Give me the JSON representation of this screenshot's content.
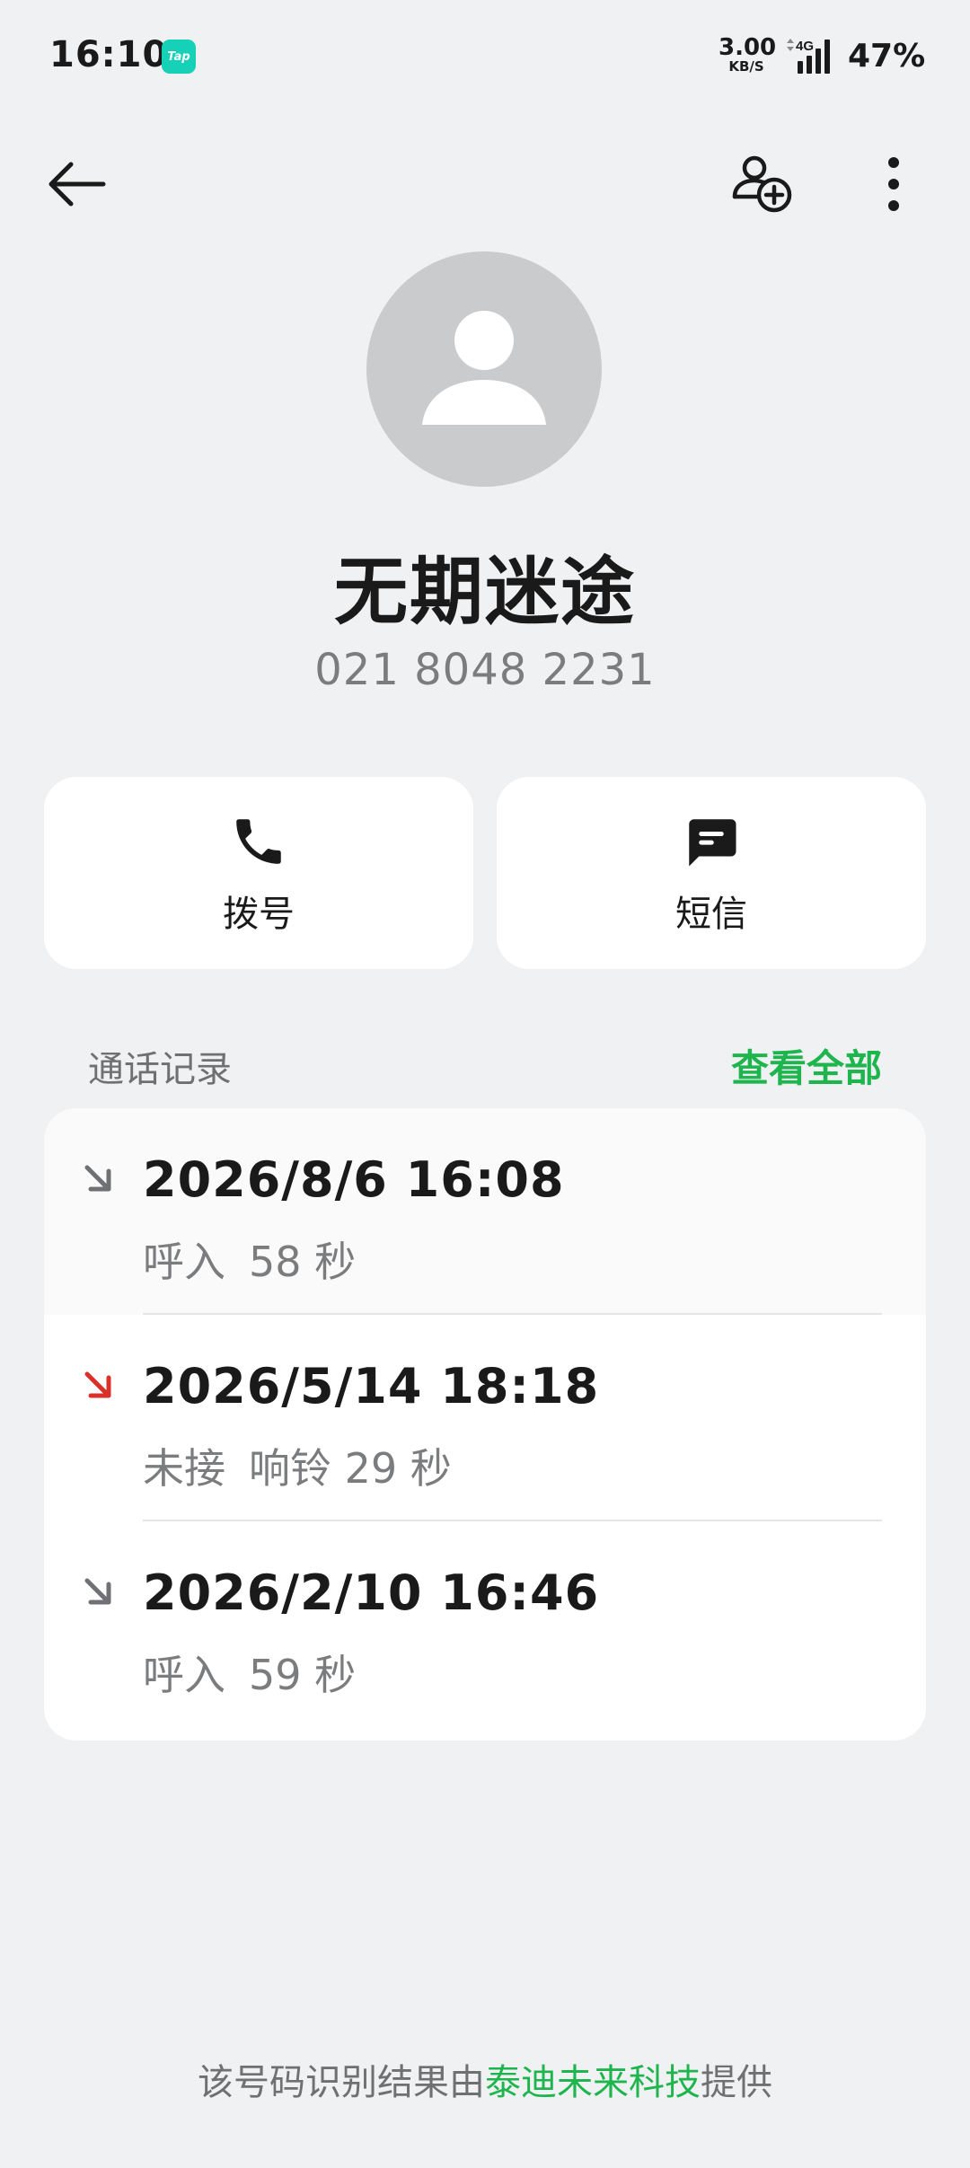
{
  "status_bar": {
    "time": "16:10",
    "app_badge": "Tap",
    "net_speed_value": "3.00",
    "net_speed_unit": "KB/S",
    "network_type": "4G",
    "battery": "47%"
  },
  "toolbar": {
    "back_icon": "arrow-left-icon",
    "add_contact_icon": "person-add-icon",
    "more_icon": "more-vertical-icon"
  },
  "contact": {
    "name": "无期迷途",
    "number": "021 8048 2231"
  },
  "actions": {
    "call_label": "拨号",
    "sms_label": "短信"
  },
  "history": {
    "title": "通话记录",
    "view_all": "查看全部",
    "items": [
      {
        "datetime": "2026/8/6 16:08",
        "type": "呼入",
        "duration": "58 秒",
        "status": "incoming"
      },
      {
        "datetime": "2026/5/14 18:18",
        "type": "未接",
        "duration": "响铃 29 秒",
        "status": "missed"
      },
      {
        "datetime": "2026/2/10 16:46",
        "type": "呼入",
        "duration": "59 秒",
        "status": "incoming"
      }
    ]
  },
  "footer": {
    "prefix": "该号码识别结果由",
    "provider": "泰迪未来科技",
    "suffix": "提供"
  },
  "colors": {
    "accent_green": "#1fb54e",
    "missed_red": "#d9302a",
    "incoming_gray": "#707174"
  }
}
